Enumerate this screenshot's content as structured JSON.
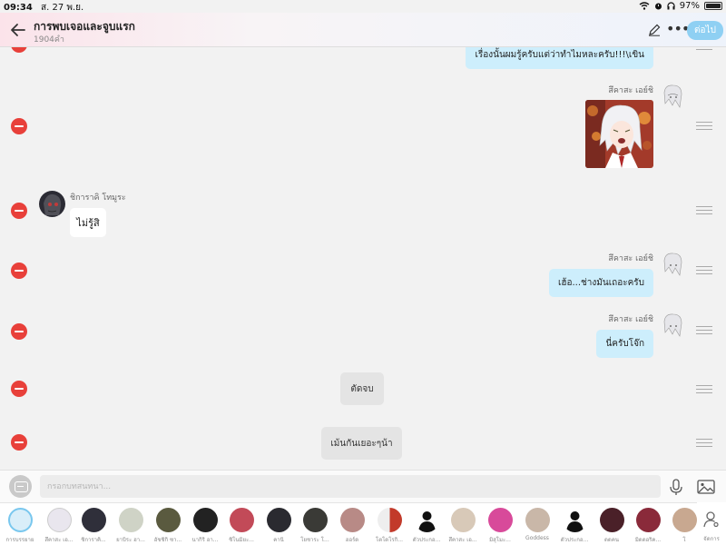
{
  "status_bar": {
    "time": "09:34",
    "date": "ส. 27 พ.ย.",
    "battery": "97%",
    "battery_level": 0.97
  },
  "header": {
    "title": "การพบเจอและจูบแรก",
    "subtitle": "1904คำ",
    "next_label": "ต่อไป"
  },
  "messages": [
    {
      "type": "right",
      "text": "เรื่องนั้นผมรู้ครับแต่ว่าทำไมหละครับ!!!\\เขิน"
    },
    {
      "type": "right-image",
      "sender": "สึคาสะ เอย์ชิ"
    },
    {
      "type": "left",
      "sender": "ชิการาคิ โทมูระ",
      "text": "ไม่รู้สิ"
    },
    {
      "type": "right",
      "sender": "สึคาสะ เอย์ชิ",
      "text": "เฮ้อ...ช่างมันเถอะครับ"
    },
    {
      "type": "right",
      "sender": "สึคาสะ เอย์ชิ",
      "text": "นี่ครับโจ๊ก"
    },
    {
      "type": "narration",
      "text": "ตัดจบ"
    },
    {
      "type": "narration",
      "text": "เม้นกันเยอะๆน้า"
    }
  ],
  "input": {
    "placeholder": "กรอกบทสนทนา..."
  },
  "characters": [
    {
      "label": "การบรรยาย"
    },
    {
      "label": "สึคาสะ เอ..."
    },
    {
      "label": "ชิการาคิ..."
    },
    {
      "label": "ยาบิระ ฮา..."
    },
    {
      "label": "อัชชิกิ ซา..."
    },
    {
      "label": "นากิริ อา..."
    },
    {
      "label": "ชิโนมิยะ..."
    },
    {
      "label": "คานิ"
    },
    {
      "label": "โยชาระ โ..."
    },
    {
      "label": "ฮอร์ด"
    },
    {
      "label": "โตโดโรกิ..."
    },
    {
      "label": "ตัวประกอ..."
    },
    {
      "label": "สึคาสะ เอ..."
    },
    {
      "label": "มิสุโมะ..."
    },
    {
      "label": "Goddess"
    },
    {
      "label": "ตัวประกอ..."
    },
    {
      "label": "ดดคน"
    },
    {
      "label": "มิดดอริค..."
    },
    {
      "label": "โ"
    }
  ],
  "manage_label": "จัดการ"
}
